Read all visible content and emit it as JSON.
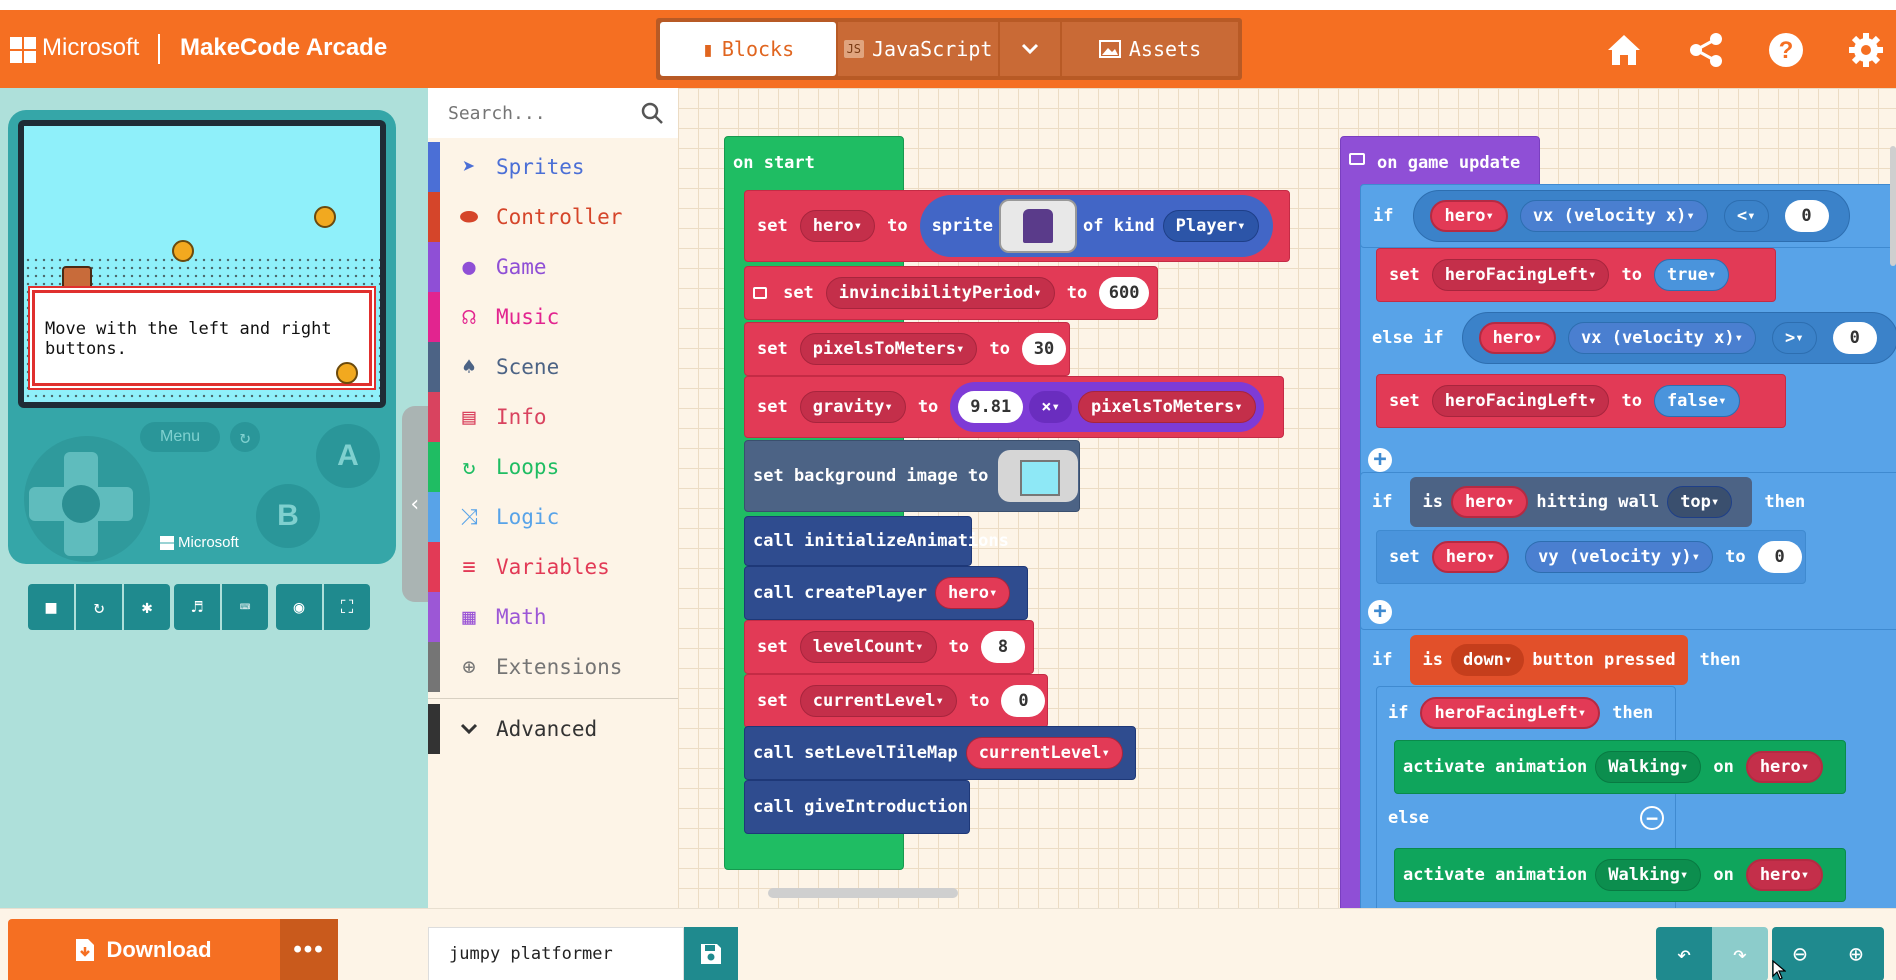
{
  "header": {
    "brand": "Microsoft",
    "app_name": "MakeCode Arcade",
    "tabs": {
      "blocks": "Blocks",
      "javascript": "JavaScript",
      "assets": "Assets"
    },
    "accent_color": "#f56f22"
  },
  "simulator": {
    "dialog_text": "Move with the left and right buttons.",
    "menu_label": "Menu",
    "button_a": "A",
    "button_b": "B",
    "device_brand": "Microsoft"
  },
  "toolbox": {
    "search_placeholder": "Search...",
    "categories": [
      {
        "label": "Sprites",
        "color": "#4b6fd6",
        "icon": "paper-plane-icon"
      },
      {
        "label": "Controller",
        "color": "#d5452a",
        "icon": "gamepad-icon"
      },
      {
        "label": "Game",
        "color": "#8f4fd6",
        "icon": "circle-icon"
      },
      {
        "label": "Music",
        "color": "#e2248f",
        "icon": "headphones-icon"
      },
      {
        "label": "Scene",
        "color": "#4c6385",
        "icon": "tree-icon"
      },
      {
        "label": "Info",
        "color": "#d9435f",
        "icon": "id-card-icon"
      },
      {
        "label": "Loops",
        "color": "#1fbd63",
        "icon": "loop-icon"
      },
      {
        "label": "Logic",
        "color": "#58a3e8",
        "icon": "shuffle-icon"
      },
      {
        "label": "Variables",
        "color": "#e23a56",
        "icon": "list-icon"
      },
      {
        "label": "Math",
        "color": "#9c57d6",
        "icon": "calculator-icon"
      },
      {
        "label": "Extensions",
        "color": "#757575",
        "icon": "plus-circle-icon"
      }
    ],
    "advanced": "Advanced"
  },
  "on_start": {
    "title": "on start",
    "set_hero": {
      "set": "set",
      "var": "hero",
      "to": "to",
      "sprite": "sprite",
      "of_kind": "of kind",
      "kind": "Player"
    },
    "set_invincibility": {
      "set": "set",
      "var": "invincibilityPeriod",
      "to": "to",
      "value": "600"
    },
    "set_pixels": {
      "set": "set",
      "var": "pixelsToMeters",
      "to": "to",
      "value": "30"
    },
    "set_gravity": {
      "set": "set",
      "var": "gravity",
      "to": "to",
      "value": "9.81",
      "op": "×",
      "operand": "pixelsToMeters"
    },
    "set_background": "set background image to",
    "call_init": "call initializeAnimations",
    "call_create": {
      "label": "call createPlayer",
      "arg": "hero"
    },
    "set_levelcount": {
      "set": "set",
      "var": "levelCount",
      "to": "to",
      "value": "8"
    },
    "set_currentlevel": {
      "set": "set",
      "var": "currentLevel",
      "to": "to",
      "value": "0"
    },
    "call_tilemap": {
      "label": "call setLevelTileMap",
      "arg": "currentLevel"
    },
    "call_intro": "call giveIntroduction"
  },
  "on_update": {
    "title": "on game update",
    "if1": {
      "if": "if",
      "sprite": "hero",
      "prop": "vx (velocity x)",
      "cmp": "<",
      "value": "0"
    },
    "set_left_true": {
      "set": "set",
      "var": "heroFacingLeft",
      "to": "to",
      "value": "true"
    },
    "elseif": {
      "label": "else if",
      "sprite": "hero",
      "prop": "vx (velocity x)",
      "cmp": ">",
      "value": "0"
    },
    "set_left_false": {
      "set": "set",
      "var": "heroFacingLeft",
      "to": "to",
      "value": "false"
    },
    "if2": {
      "if": "if",
      "is": "is",
      "sprite": "hero",
      "hitting": "hitting wall",
      "side": "top",
      "then": "then"
    },
    "set_vy": {
      "set": "set",
      "sprite": "hero",
      "prop": "vy (velocity y)",
      "to": "to",
      "value": "0"
    },
    "if3": {
      "if": "if",
      "is": "is",
      "button": "down",
      "pressed": "button pressed",
      "then": "then"
    },
    "if4": {
      "if": "if",
      "var": "heroFacingLeft",
      "then": "then"
    },
    "anim1": {
      "label": "activate animation",
      "anim": "Walking",
      "on": "on",
      "sprite": "hero"
    },
    "else": "else",
    "anim2": {
      "label": "activate animation",
      "anim": "Walking",
      "on": "on",
      "sprite": "hero"
    }
  },
  "footer": {
    "download": "Download",
    "more": "•••",
    "project_name": "jumpy platformer"
  }
}
